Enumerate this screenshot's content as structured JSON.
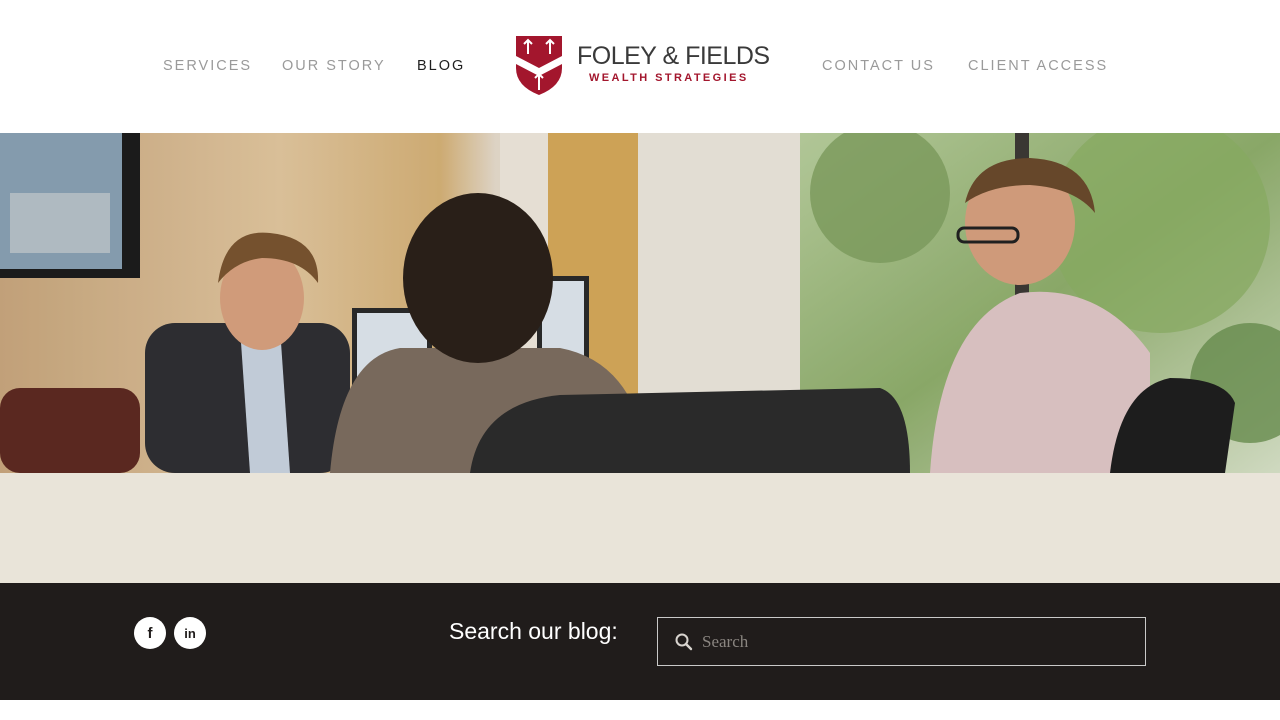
{
  "header": {
    "nav_left": [
      {
        "label": "SERVICES"
      },
      {
        "label": "OUR STORY"
      },
      {
        "label": "BLOG",
        "active": true
      }
    ],
    "nav_right": [
      {
        "label": "CONTACT US"
      },
      {
        "label": "CLIENT ACCESS"
      }
    ],
    "logo": {
      "name": "FOLEY & FIELDS",
      "tagline": "WEALTH STRATEGIES",
      "icon": "shield-arrows-icon",
      "brand_color": "#a3162d"
    }
  },
  "hero": {
    "description_icon": "office-meeting-photo"
  },
  "footer": {
    "social": [
      {
        "icon": "facebook-icon",
        "glyph": "f"
      },
      {
        "icon": "linkedin-icon",
        "glyph": "in"
      }
    ],
    "search_label": "Search our blog:",
    "search_placeholder": "Search"
  },
  "colors": {
    "nav_inactive": "#9a9a9a",
    "nav_active": "#1f1f1f",
    "band": "#e9e4d9",
    "footer_bg": "#201c1b"
  }
}
